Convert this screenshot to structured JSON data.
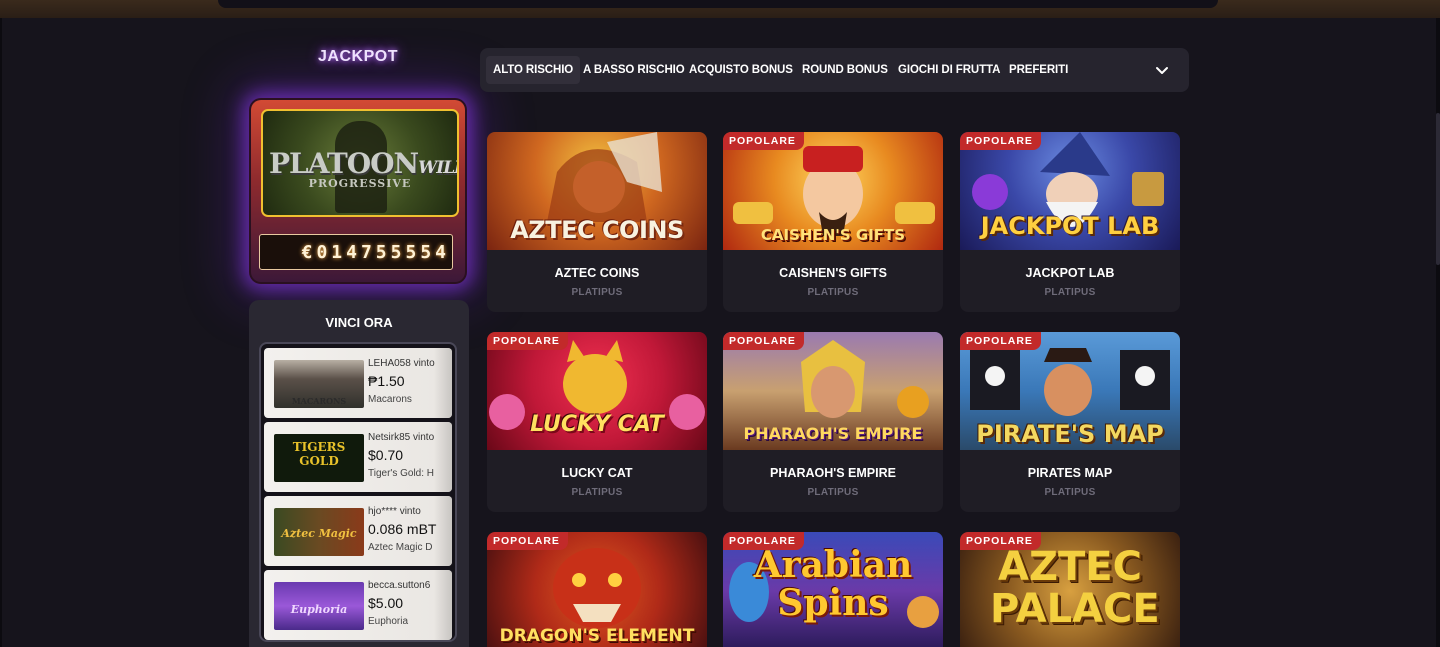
{
  "jackpot": {
    "title": "JACKPOT",
    "game_logo_line1": "PLATOON",
    "game_logo_wild": "WILD",
    "game_logo_line2": "PROGRESSIVE",
    "amount": "€014755554"
  },
  "winners": {
    "title": "VINCI ORA",
    "items": [
      {
        "user": "LEHA058 vinto",
        "amount": "₱1.50",
        "game": "Macarons",
        "thumb_label": "MACARONS"
      },
      {
        "user": "Netsirk85 vinto",
        "amount": "$0.70",
        "game": "Tiger's Gold: H",
        "thumb_label": "TIGERS GOLD"
      },
      {
        "user": "hjo**** vinto",
        "amount": "0.086 mBT",
        "game": "Aztec Magic D",
        "thumb_label": "Aztec Magic"
      },
      {
        "user": "becca.sutton6",
        "amount": "$5.00",
        "game": "Euphoria",
        "thumb_label": "Euphoria"
      }
    ]
  },
  "tabs": [
    {
      "label": "ALTO RISCHIO",
      "active": true
    },
    {
      "label": "A BASSO RISCHIO",
      "active": false
    },
    {
      "label": "ACQUISTO BONUS",
      "active": false
    },
    {
      "label": "ROUND BONUS",
      "active": false
    },
    {
      "label": "GIOCHI DI FRUTTA",
      "active": false
    },
    {
      "label": "PREFERITI",
      "active": false
    }
  ],
  "badge_label": "POPOLARE",
  "games": [
    {
      "name": "AZTEC COINS",
      "provider": "PLATIPUS",
      "popular": false,
      "logo": "AZTEC COINS"
    },
    {
      "name": "CAISHEN'S GIFTS",
      "provider": "PLATIPUS",
      "popular": true,
      "logo": "CAISHEN'S GIFTS"
    },
    {
      "name": "JACKPOT LAB",
      "provider": "PLATIPUS",
      "popular": true,
      "logo": "JACKPOT LAB"
    },
    {
      "name": "LUCKY CAT",
      "provider": "PLATIPUS",
      "popular": true,
      "logo": "LUCKY CAT"
    },
    {
      "name": "PHARAOH'S EMPIRE",
      "provider": "PLATIPUS",
      "popular": true,
      "logo": "PHARAOH'S EMPIRE"
    },
    {
      "name": "PIRATES MAP",
      "provider": "PLATIPUS",
      "popular": true,
      "logo": "PIRATE'S MAP"
    },
    {
      "name": "",
      "provider": "",
      "popular": true,
      "logo": "DRAGON'S ELEMENT"
    },
    {
      "name": "",
      "provider": "",
      "popular": true,
      "logo": "Arabian Spins"
    },
    {
      "name": "",
      "provider": "",
      "popular": true,
      "logo": "AZTEC PALACE"
    }
  ],
  "colors": {
    "background": "#16141c",
    "badge": "#c22a2a",
    "jackpot_glow": "#9a3cff",
    "panel": "#26242e"
  }
}
